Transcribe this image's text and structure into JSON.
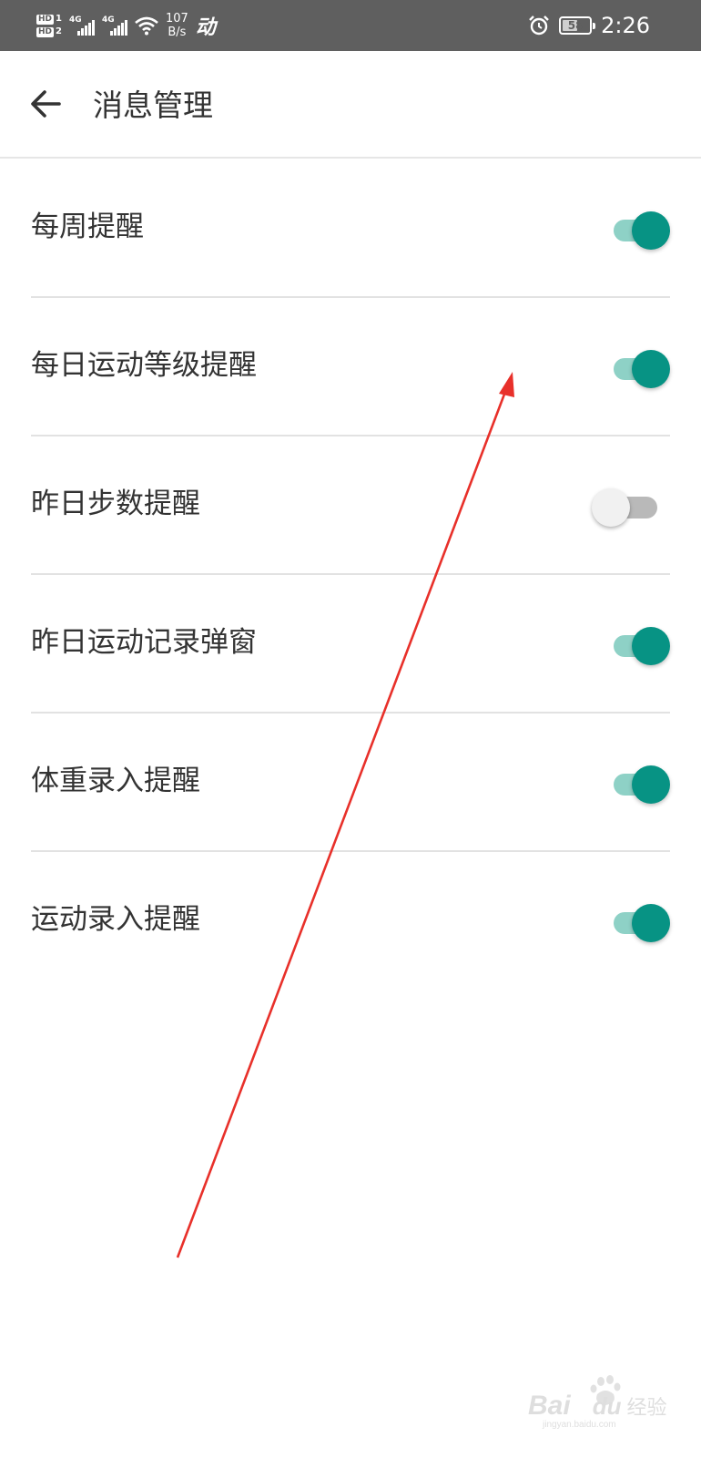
{
  "status_bar": {
    "sim1_label": "HD",
    "sim1_num": "1",
    "sim2_label": "HD",
    "sim2_num": "2",
    "network1": "4G",
    "network2": "4G",
    "speed_value": "107",
    "speed_unit": "B/s",
    "app_indicator": "动",
    "battery_percent": "58",
    "battery_level": 0.58,
    "time": "2:26",
    "icons": [
      "sim-hd-icon",
      "signal-icon",
      "wifi-icon",
      "alarm-icon",
      "battery-icon"
    ]
  },
  "app_bar": {
    "back_icon": "arrow-left-icon",
    "title": "消息管理"
  },
  "settings": [
    {
      "label": "每周提醒",
      "enabled": true
    },
    {
      "label": "每日运动等级提醒",
      "enabled": true
    },
    {
      "label": "昨日步数提醒",
      "enabled": false
    },
    {
      "label": "昨日运动记录弹窗",
      "enabled": true
    },
    {
      "label": "体重录入提醒",
      "enabled": true
    },
    {
      "label": "运动录入提醒",
      "enabled": true
    }
  ],
  "colors": {
    "status_bar_bg": "#5f5f5f",
    "toggle_on_knob": "#079384",
    "toggle_on_track": "#8ed1c6",
    "toggle_off_knob": "#f1f1f1",
    "toggle_off_track": "#b9b9b9",
    "annotation_arrow": "#e8302a"
  },
  "watermark": {
    "brand": "Bai",
    "brand_paw": "du",
    "suffix": "经验",
    "url": "jingyan.baidu.com"
  }
}
